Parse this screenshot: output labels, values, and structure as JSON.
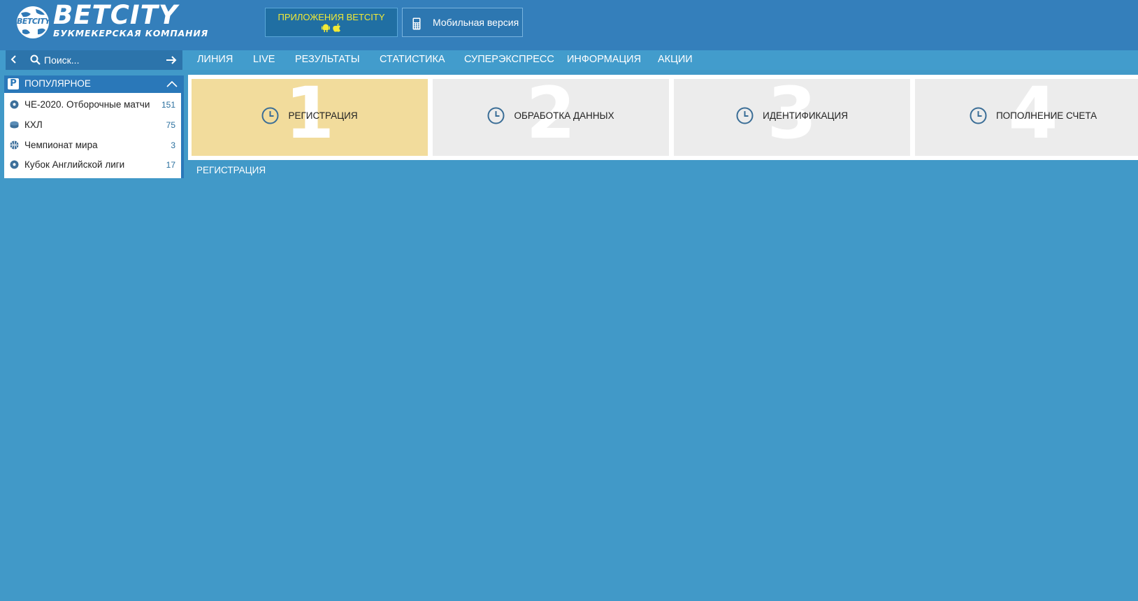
{
  "logo": {
    "globe_text": "BETCITY",
    "title": "BETCITY",
    "subtitle": "БУКМЕКЕРСКАЯ КОМПАНИЯ"
  },
  "header": {
    "apps_label": "ПРИЛОЖЕНИЯ BETCITY",
    "apps_icons": [
      "android-icon",
      "apple-icon"
    ],
    "mobile_label": "Мобильная версия",
    "mobile_icon": "phone-icon"
  },
  "search": {
    "placeholder": "Поиск..."
  },
  "nav": {
    "items": [
      "ЛИНИЯ",
      "LIVE",
      "РЕЗУЛЬТАТЫ",
      "СТАТИСТИКА",
      "СУПЕРЭКСПРЕСС",
      "ИНФОРМАЦИЯ",
      "АКЦИИ"
    ]
  },
  "sidebar": {
    "title": "ПОПУЛЯРНОЕ",
    "items": [
      {
        "label": "ЧЕ-2020. Отборочные матчи",
        "count": "151",
        "icon": "soccer-ball-icon"
      },
      {
        "label": "КХЛ",
        "count": "75",
        "icon": "hockey-puck-icon"
      },
      {
        "label": "Чемпионат мира",
        "count": "3",
        "icon": "basketball-icon"
      },
      {
        "label": "Кубок Английской лиги",
        "count": "17",
        "icon": "soccer-ball-icon"
      }
    ]
  },
  "steps": [
    {
      "number": "1",
      "label": "РЕГИСТРАЦИЯ",
      "active": true
    },
    {
      "number": "2",
      "label": "ОБРАБОТКА ДАННЫХ",
      "active": false
    },
    {
      "number": "3",
      "label": "ИДЕНТИФИКАЦИЯ",
      "active": false
    },
    {
      "number": "4",
      "label": "ПОПОЛНЕНИЕ СЧЕТА",
      "active": false
    }
  ],
  "section_title": "РЕГИСТРАЦИЯ",
  "colors": {
    "page_bg": "#4199c8",
    "header_bg": "#347fbb",
    "active_step": "#f2dc9c",
    "inactive_step": "#ececec",
    "apps_text": "#f2ea34"
  }
}
